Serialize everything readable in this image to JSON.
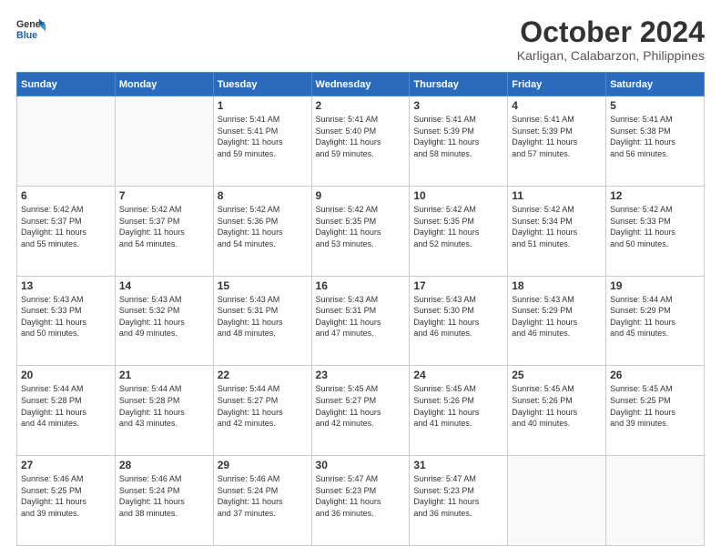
{
  "logo": {
    "line1": "General",
    "line2": "Blue"
  },
  "title": "October 2024",
  "subtitle": "Karligan, Calabarzon, Philippines",
  "days_of_week": [
    "Sunday",
    "Monday",
    "Tuesday",
    "Wednesday",
    "Thursday",
    "Friday",
    "Saturday"
  ],
  "weeks": [
    [
      {
        "day": "",
        "info": ""
      },
      {
        "day": "",
        "info": ""
      },
      {
        "day": "1",
        "info": "Sunrise: 5:41 AM\nSunset: 5:41 PM\nDaylight: 11 hours\nand 59 minutes."
      },
      {
        "day": "2",
        "info": "Sunrise: 5:41 AM\nSunset: 5:40 PM\nDaylight: 11 hours\nand 59 minutes."
      },
      {
        "day": "3",
        "info": "Sunrise: 5:41 AM\nSunset: 5:39 PM\nDaylight: 11 hours\nand 58 minutes."
      },
      {
        "day": "4",
        "info": "Sunrise: 5:41 AM\nSunset: 5:39 PM\nDaylight: 11 hours\nand 57 minutes."
      },
      {
        "day": "5",
        "info": "Sunrise: 5:41 AM\nSunset: 5:38 PM\nDaylight: 11 hours\nand 56 minutes."
      }
    ],
    [
      {
        "day": "6",
        "info": "Sunrise: 5:42 AM\nSunset: 5:37 PM\nDaylight: 11 hours\nand 55 minutes."
      },
      {
        "day": "7",
        "info": "Sunrise: 5:42 AM\nSunset: 5:37 PM\nDaylight: 11 hours\nand 54 minutes."
      },
      {
        "day": "8",
        "info": "Sunrise: 5:42 AM\nSunset: 5:36 PM\nDaylight: 11 hours\nand 54 minutes."
      },
      {
        "day": "9",
        "info": "Sunrise: 5:42 AM\nSunset: 5:35 PM\nDaylight: 11 hours\nand 53 minutes."
      },
      {
        "day": "10",
        "info": "Sunrise: 5:42 AM\nSunset: 5:35 PM\nDaylight: 11 hours\nand 52 minutes."
      },
      {
        "day": "11",
        "info": "Sunrise: 5:42 AM\nSunset: 5:34 PM\nDaylight: 11 hours\nand 51 minutes."
      },
      {
        "day": "12",
        "info": "Sunrise: 5:42 AM\nSunset: 5:33 PM\nDaylight: 11 hours\nand 50 minutes."
      }
    ],
    [
      {
        "day": "13",
        "info": "Sunrise: 5:43 AM\nSunset: 5:33 PM\nDaylight: 11 hours\nand 50 minutes."
      },
      {
        "day": "14",
        "info": "Sunrise: 5:43 AM\nSunset: 5:32 PM\nDaylight: 11 hours\nand 49 minutes."
      },
      {
        "day": "15",
        "info": "Sunrise: 5:43 AM\nSunset: 5:31 PM\nDaylight: 11 hours\nand 48 minutes."
      },
      {
        "day": "16",
        "info": "Sunrise: 5:43 AM\nSunset: 5:31 PM\nDaylight: 11 hours\nand 47 minutes."
      },
      {
        "day": "17",
        "info": "Sunrise: 5:43 AM\nSunset: 5:30 PM\nDaylight: 11 hours\nand 46 minutes."
      },
      {
        "day": "18",
        "info": "Sunrise: 5:43 AM\nSunset: 5:29 PM\nDaylight: 11 hours\nand 46 minutes."
      },
      {
        "day": "19",
        "info": "Sunrise: 5:44 AM\nSunset: 5:29 PM\nDaylight: 11 hours\nand 45 minutes."
      }
    ],
    [
      {
        "day": "20",
        "info": "Sunrise: 5:44 AM\nSunset: 5:28 PM\nDaylight: 11 hours\nand 44 minutes."
      },
      {
        "day": "21",
        "info": "Sunrise: 5:44 AM\nSunset: 5:28 PM\nDaylight: 11 hours\nand 43 minutes."
      },
      {
        "day": "22",
        "info": "Sunrise: 5:44 AM\nSunset: 5:27 PM\nDaylight: 11 hours\nand 42 minutes."
      },
      {
        "day": "23",
        "info": "Sunrise: 5:45 AM\nSunset: 5:27 PM\nDaylight: 11 hours\nand 42 minutes."
      },
      {
        "day": "24",
        "info": "Sunrise: 5:45 AM\nSunset: 5:26 PM\nDaylight: 11 hours\nand 41 minutes."
      },
      {
        "day": "25",
        "info": "Sunrise: 5:45 AM\nSunset: 5:26 PM\nDaylight: 11 hours\nand 40 minutes."
      },
      {
        "day": "26",
        "info": "Sunrise: 5:45 AM\nSunset: 5:25 PM\nDaylight: 11 hours\nand 39 minutes."
      }
    ],
    [
      {
        "day": "27",
        "info": "Sunrise: 5:46 AM\nSunset: 5:25 PM\nDaylight: 11 hours\nand 39 minutes."
      },
      {
        "day": "28",
        "info": "Sunrise: 5:46 AM\nSunset: 5:24 PM\nDaylight: 11 hours\nand 38 minutes."
      },
      {
        "day": "29",
        "info": "Sunrise: 5:46 AM\nSunset: 5:24 PM\nDaylight: 11 hours\nand 37 minutes."
      },
      {
        "day": "30",
        "info": "Sunrise: 5:47 AM\nSunset: 5:23 PM\nDaylight: 11 hours\nand 36 minutes."
      },
      {
        "day": "31",
        "info": "Sunrise: 5:47 AM\nSunset: 5:23 PM\nDaylight: 11 hours\nand 36 minutes."
      },
      {
        "day": "",
        "info": ""
      },
      {
        "day": "",
        "info": ""
      }
    ]
  ]
}
